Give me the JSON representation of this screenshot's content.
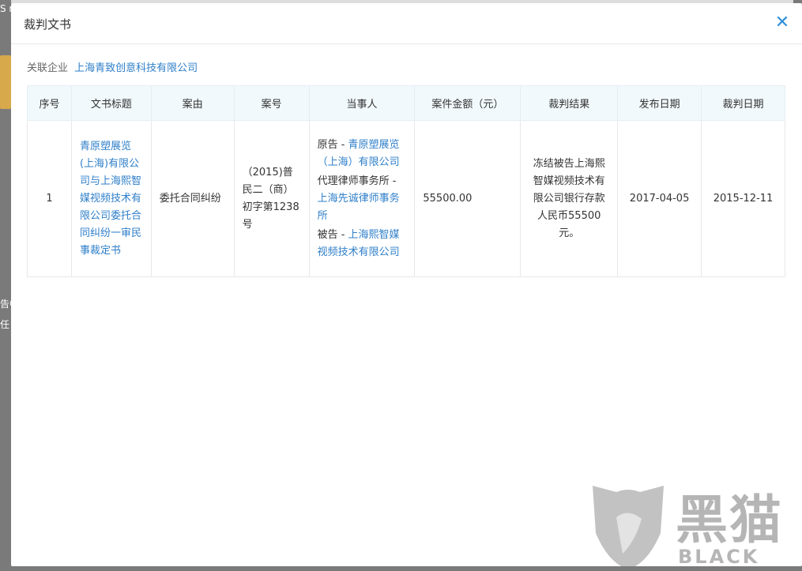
{
  "modal": {
    "title": "裁判文书",
    "close_icon": "close-icon",
    "accent_color": "#2f8fd9"
  },
  "related": {
    "label": "关联企业",
    "company": "上海青致创意科技有限公司"
  },
  "table": {
    "headers": [
      "序号",
      "文书标题",
      "案由",
      "案号",
      "当事人",
      "案件金额（元）",
      "裁判结果",
      "发布日期",
      "裁判日期"
    ],
    "rows": [
      {
        "index": "1",
        "title": "青原塑展览(上海)有限公司与上海熙智媒视频技术有限公司委托合同纠纷一审民事裁定书",
        "cause": "委托合同纠纷",
        "case_no": "（2015)普民二（商）初字第1238号",
        "parties": {
          "plaintiff_label": "原告 - ",
          "plaintiff": "青原塑展览（上海）有限公司",
          "agent_label": "代理律师事务所 - ",
          "agent": "上海先诚律师事务所",
          "defendant_label": "被告 - ",
          "defendant": "上海熙智媒视频技术有限公司"
        },
        "amount": "55500.00",
        "result": "冻结被告上海熙智媒视频技术有限公司银行存款人民币55500元。",
        "publish_date": "2017-04-05",
        "judge_date": "2015-12-11"
      }
    ]
  },
  "watermark": {
    "cn": "黑猫",
    "en": "BLACK CAT"
  },
  "background": {
    "snip1": "S n",
    "snip2": "告中",
    "snip3": "任"
  }
}
